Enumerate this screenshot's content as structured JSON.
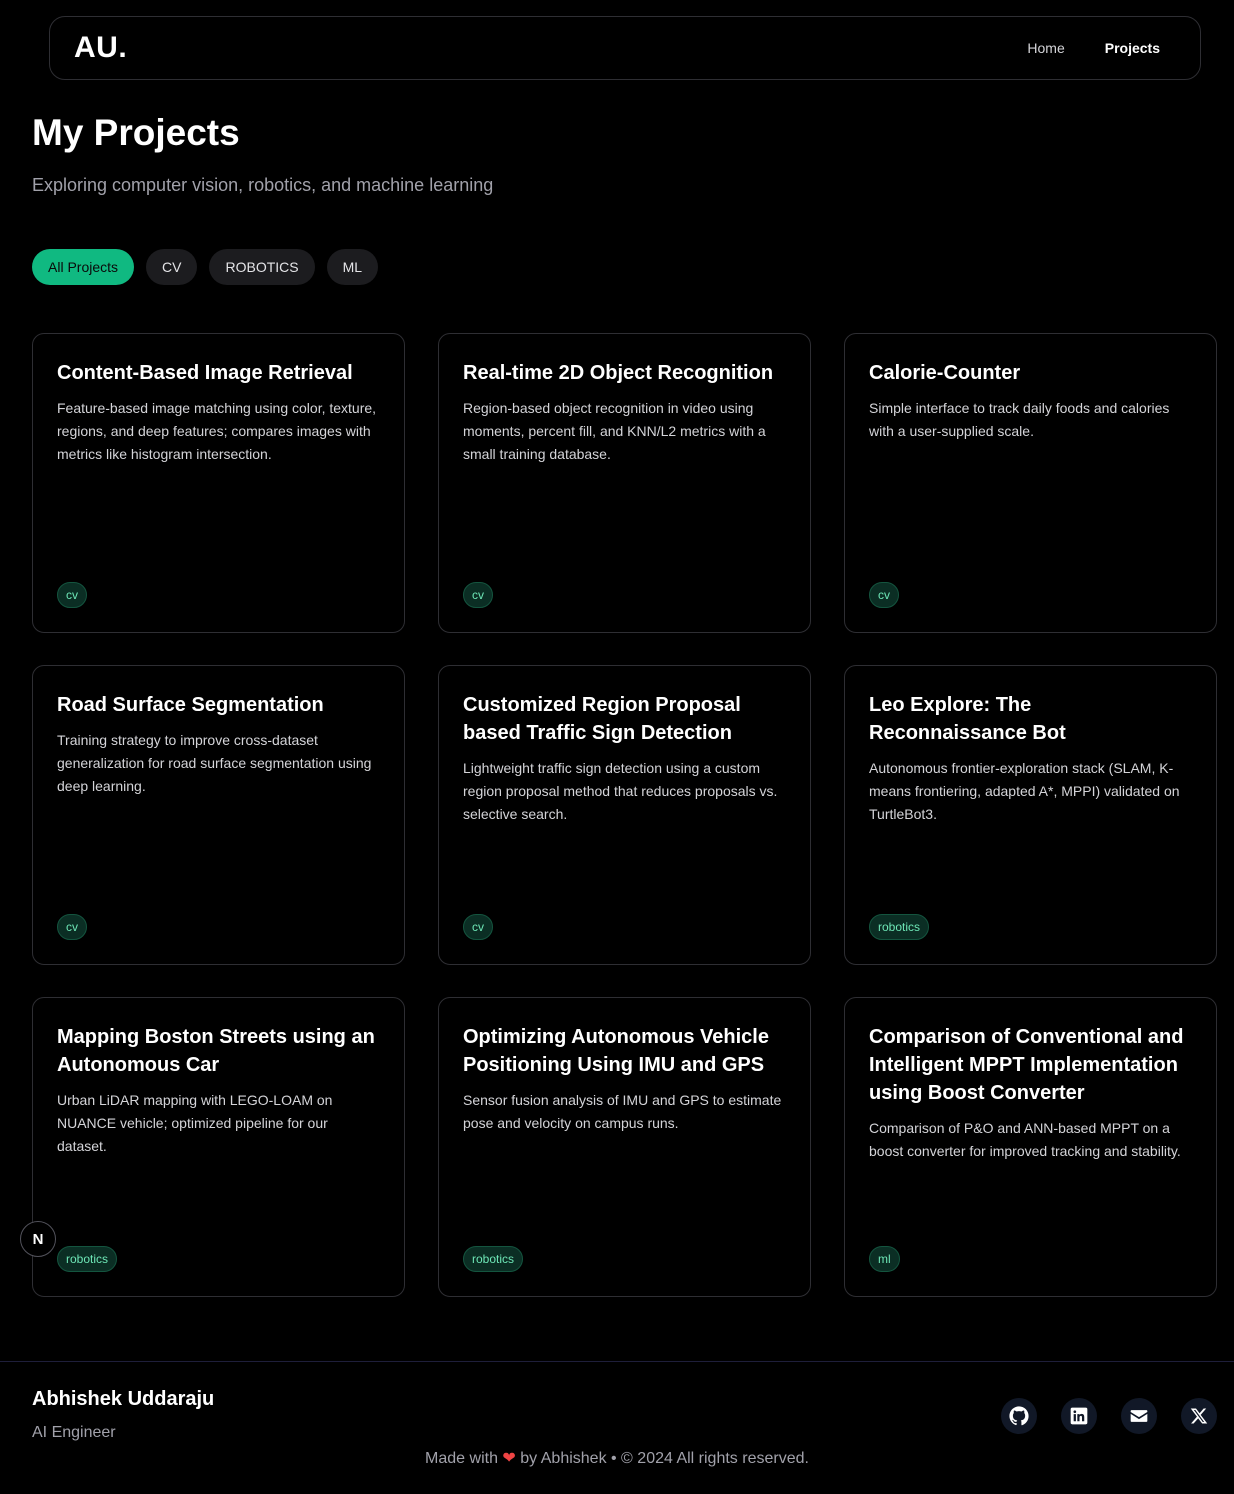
{
  "nav": {
    "logo": "AU.",
    "links": [
      {
        "label": "Home"
      },
      {
        "label": "Projects"
      }
    ]
  },
  "header": {
    "title": "My Projects",
    "subtitle": "Exploring computer vision, robotics, and machine learning"
  },
  "filters": [
    "All Projects",
    "CV",
    "ROBOTICS",
    "ML"
  ],
  "projects": [
    {
      "title": "Content-Based Image Retrieval",
      "description": "Feature-based image matching using color, texture, regions, and deep features; compares images with metrics like histogram intersection.",
      "tag": "cv"
    },
    {
      "title": "Real-time 2D Object Recognition",
      "description": "Region-based object recognition in video using moments, percent fill, and KNN/L2 metrics with a small training database.",
      "tag": "cv"
    },
    {
      "title": "Calorie-Counter",
      "description": "Simple interface to track daily foods and calories with a user-supplied scale.",
      "tag": "cv"
    },
    {
      "title": "Road Surface Segmentation",
      "description": "Training strategy to improve cross-dataset generalization for road surface segmentation using deep learning.",
      "tag": "cv"
    },
    {
      "title": "Customized Region Proposal based Traffic Sign Detection",
      "description": "Lightweight traffic sign detection using a custom region proposal method that reduces proposals vs. selective search.",
      "tag": "cv"
    },
    {
      "title": "Leo Explore: The Reconnaissance Bot",
      "description": "Autonomous frontier-exploration stack (SLAM, K-means frontiering, adapted A*, MPPI) validated on TurtleBot3.",
      "tag": "robotics"
    },
    {
      "title": "Mapping Boston Streets using an Autonomous Car",
      "description": "Urban LiDAR mapping with LEGO-LOAM on NUANCE vehicle; optimized pipeline for our dataset.",
      "tag": "robotics"
    },
    {
      "title": "Optimizing Autonomous Vehicle Positioning Using IMU and GPS",
      "description": "Sensor fusion analysis of IMU and GPS to estimate pose and velocity on campus runs.",
      "tag": "robotics"
    },
    {
      "title": "Comparison of Conventional and Intelligent MPPT Implementation using Boost Converter",
      "description": "Comparison of P&O and ANN-based MPPT on a boost converter for improved tracking and stability.",
      "tag": "ml"
    }
  ],
  "badge": "N",
  "footer": {
    "name": "Abhishek Uddaraju",
    "role": "AI Engineer",
    "made_with": "Made with",
    "heart": "❤",
    "copyright": "by Abhishek • © 2024 All rights reserved.",
    "social_icons": [
      "github-icon",
      "linkedin-icon",
      "mail-icon",
      "x-icon"
    ]
  },
  "colors": {
    "accent": "#10b981",
    "background": "#000000",
    "tag_text": "#6ee7b7",
    "heart": "#ef4444"
  }
}
